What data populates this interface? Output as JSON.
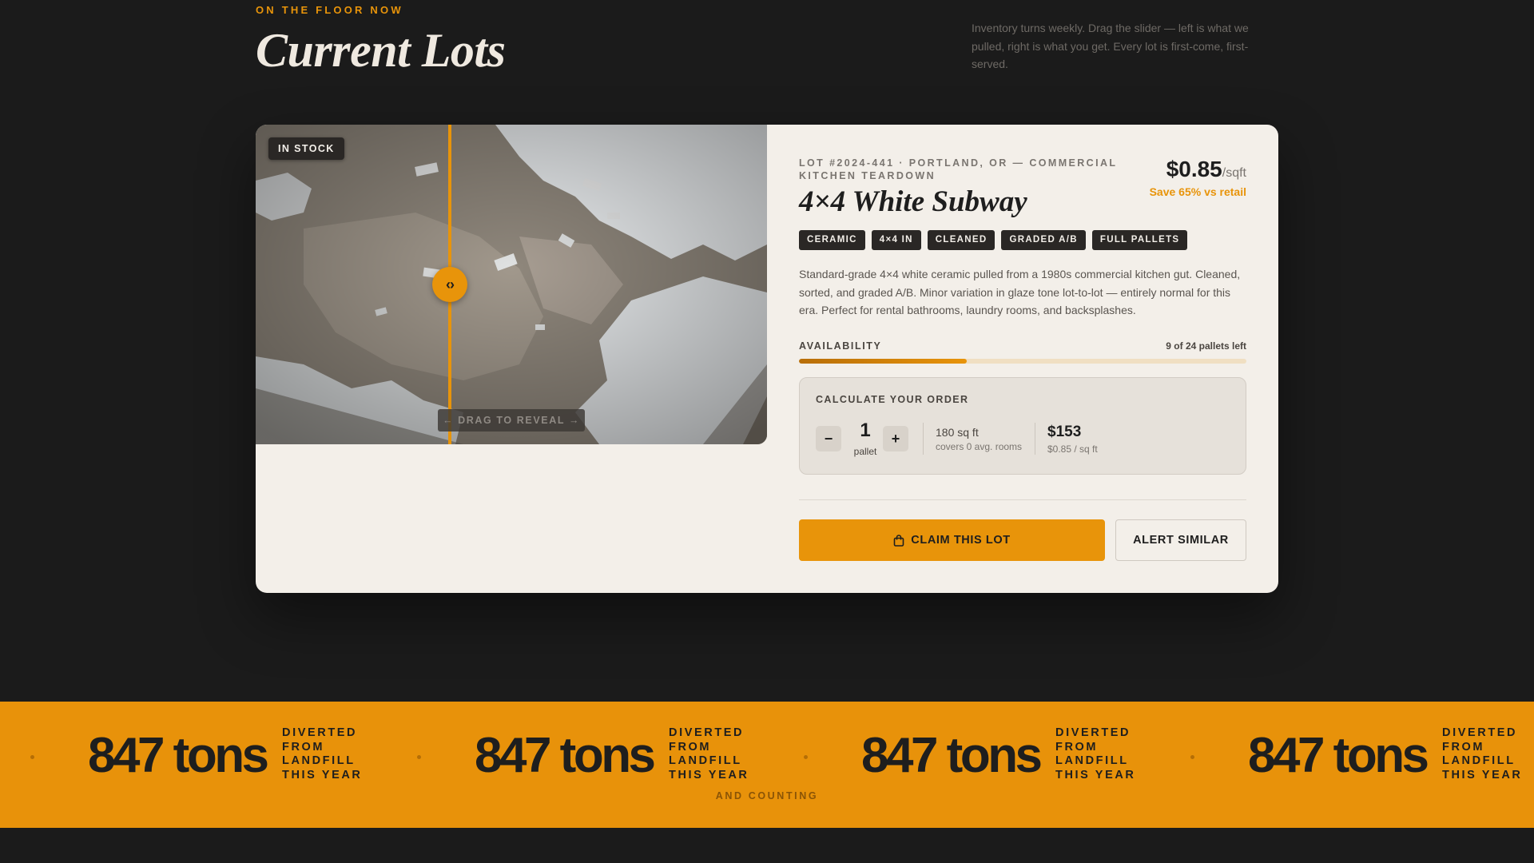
{
  "header": {
    "eyebrow": "ON THE FLOOR NOW",
    "title": "Current Lots",
    "intro": "Inventory turns weekly. Drag the slider — left is what we pulled, right is what you get. Every lot is first-come, first-served."
  },
  "lot": {
    "status_badge": "IN STOCK",
    "drag_hint": "← DRAG TO REVEAL →",
    "handle_icon": "‹›",
    "meta": "LOT #2024-441 · PORTLAND, OR — COMMERCIAL KITCHEN TEARDOWN",
    "title": "4×4 White Subway",
    "price": "$0.85",
    "price_unit": "/sqft",
    "savings": "Save 65% vs retail",
    "tags": [
      "CERAMIC",
      "4×4 IN",
      "CLEANED",
      "GRADED A/B",
      "FULL PALLETS"
    ],
    "description": "Standard-grade 4×4 white ceramic pulled from a 1980s commercial kitchen gut. Cleaned, sorted, and graded A/B. Minor variation in glaze tone lot-to-lot — entirely normal for this era. Perfect for rental bathrooms, laundry rooms, and backsplashes.",
    "availability": {
      "label": "AVAILABILITY",
      "count_text": "9 of 24 pallets left",
      "remaining": 9,
      "total": 24
    },
    "calculator": {
      "label": "CALCULATE YOUR ORDER",
      "minus": "−",
      "plus": "+",
      "quantity": "1",
      "unit": "pallet",
      "sqft": "180 sq ft",
      "rooms": "covers 0 avg. rooms",
      "total": "$153",
      "total_sub": "$0.85 / sq ft"
    },
    "actions": {
      "claim": "CLAIM THIS LOT",
      "claim_icon": "bag-icon",
      "alert": "ALERT SIMILAR"
    }
  },
  "ticker": {
    "big": "847 tons",
    "small": "DIVERTED FROM LANDFILL THIS YEAR",
    "foot": "AND COUNTING"
  },
  "colors": {
    "accent": "#e8940a",
    "background": "#1b1b1b",
    "card": "#f3efe9",
    "dark_tag": "#2a2725"
  }
}
